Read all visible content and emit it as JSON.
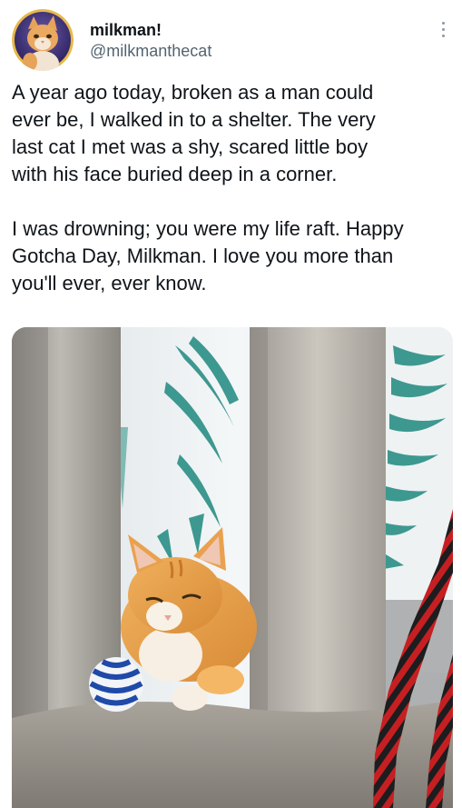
{
  "tweet": {
    "author": {
      "display_name": "milkman!",
      "handle": "@milkmanthecat"
    },
    "text_paragraphs": [
      "A year ago today, broken as a man could\never be, I walked in to a shelter. The very\nlast cat I met was a shy, scared little boy\nwith his face buried deep in a corner.",
      "I was drowning; you were my life raft. Happy\nGotcha Day, Milkman. I love you more than\nyou'll ever, ever know."
    ],
    "icons": {
      "more": "more-options-icon"
    },
    "colors": {
      "text": "#0f1419",
      "secondary_text": "#536471",
      "avatar_ring": "#e8b84a"
    }
  }
}
